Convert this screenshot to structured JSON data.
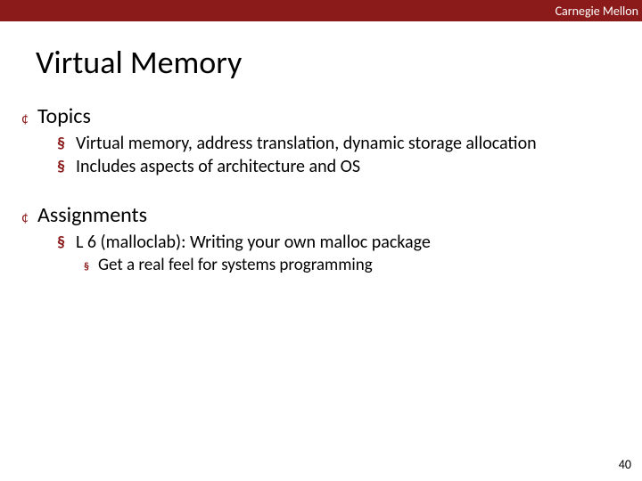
{
  "header": {
    "institution": "Carnegie Mellon"
  },
  "slide": {
    "title": "Virtual Memory",
    "page_number": "40"
  },
  "sections": [
    {
      "heading": "Topics",
      "items": [
        {
          "text": "Virtual memory, address translation, dynamic storage allocation"
        },
        {
          "text": "Includes aspects of architecture and OS"
        }
      ]
    },
    {
      "heading": "Assignments",
      "items": [
        {
          "text": "L 6 (malloclab): Writing your own malloc package",
          "subitems": [
            {
              "text": "Get a real feel for systems programming"
            }
          ]
        }
      ]
    }
  ]
}
